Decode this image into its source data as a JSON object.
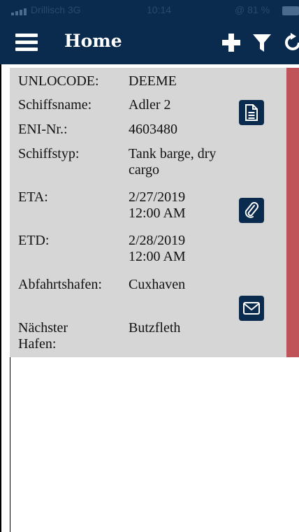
{
  "status_bar": {
    "carrier": "Drillisch 3G",
    "time": "10:14",
    "battery_pct": "@ 81 %"
  },
  "nav": {
    "title": "Home",
    "actions": [
      {
        "icon": "plus-icon"
      },
      {
        "icon": "filter-icon"
      },
      {
        "icon": "refresh-icon"
      }
    ]
  },
  "card": {
    "accent_color": "#c0525a",
    "rows": [
      {
        "label": "UNLOCODE:",
        "value": "DEEME"
      },
      {
        "label": "Schiffsname:",
        "value": "Adler 2"
      },
      {
        "label": "ENI-Nr.:",
        "value": "4603480"
      },
      {
        "label": "Schiffstyp:",
        "value": "Tank barge, dry cargo"
      },
      {
        "label": "ETA:",
        "value": "2/27/2019 12:00 AM"
      },
      {
        "label": "ETD:",
        "value": "2/28/2019 12:00 AM"
      },
      {
        "label": "Abfahrtshafen:",
        "value": "Cuxhaven"
      },
      {
        "label": "Nächster Hafen:",
        "value": "Butzfleth"
      }
    ],
    "actions": [
      {
        "icon": "document-icon"
      },
      {
        "icon": "paperclip-icon"
      },
      {
        "icon": "mail-icon"
      }
    ]
  }
}
